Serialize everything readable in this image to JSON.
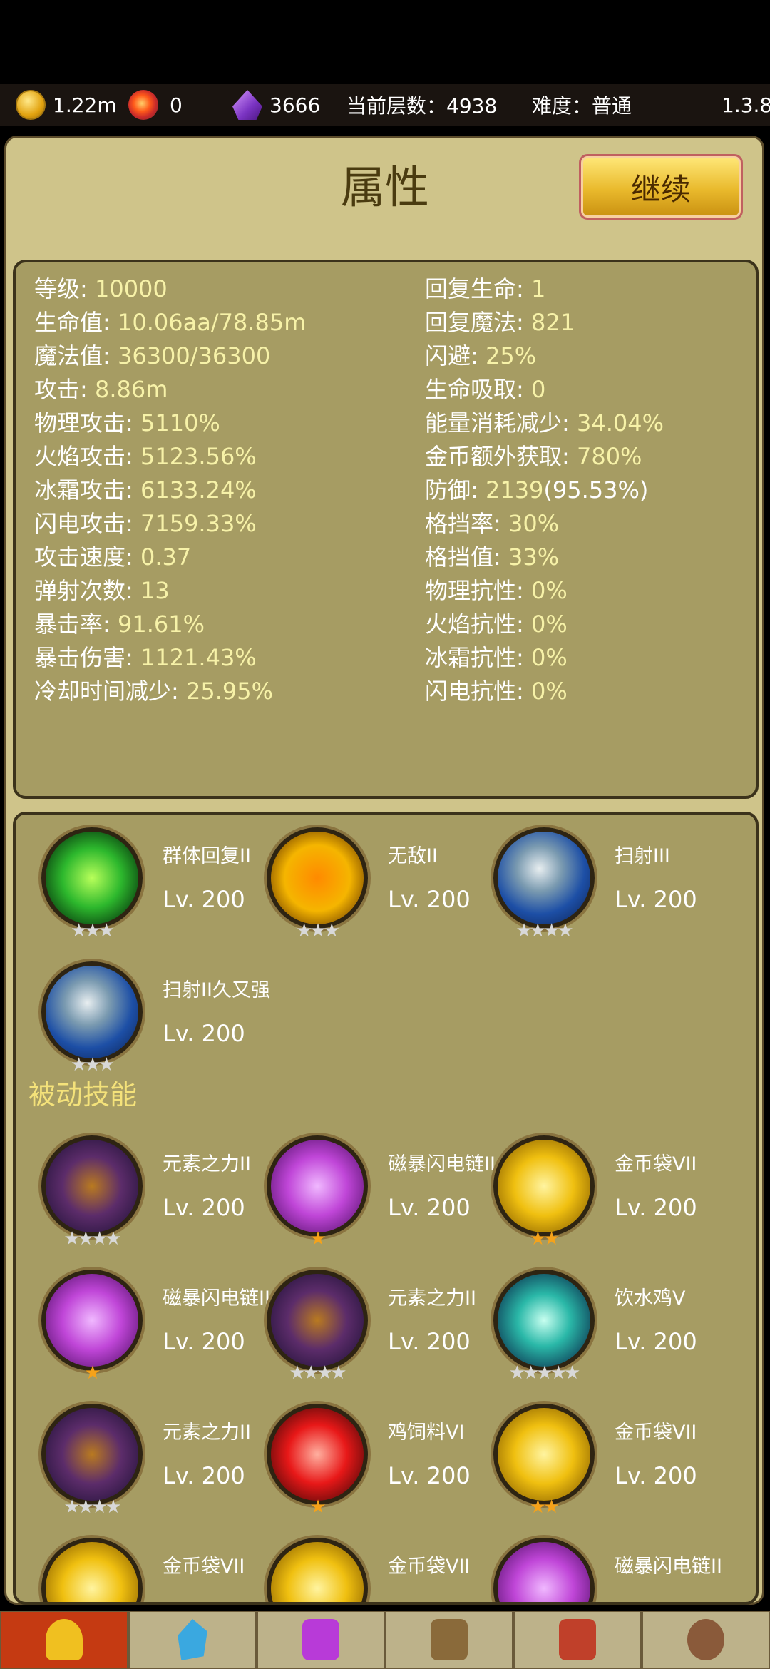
{
  "topbar": {
    "gold": "1.22m",
    "bombs": "0",
    "gems": "3666",
    "floor_label": "当前层数：4938",
    "difficulty_label": "难度：普通",
    "version": "1.3.8"
  },
  "header": {
    "title": "属性",
    "continue_label": "继续"
  },
  "stats_left": [
    {
      "label": "等级: ",
      "value": "10000"
    },
    {
      "label": "生命值: ",
      "value": "10.06aa/78.85m"
    },
    {
      "label": "魔法值: ",
      "value": "36300/36300"
    },
    {
      "label": "攻击: ",
      "value": "8.86m"
    },
    {
      "label": "物理攻击: ",
      "value": "5110%"
    },
    {
      "label": "火焰攻击: ",
      "value": "5123.56%"
    },
    {
      "label": "冰霜攻击: ",
      "value": "6133.24%"
    },
    {
      "label": "闪电攻击: ",
      "value": "7159.33%"
    },
    {
      "label": "攻击速度: ",
      "value": "0.37"
    },
    {
      "label": "弹射次数: ",
      "value": "13"
    },
    {
      "label": "暴击率: ",
      "value": "91.61%"
    },
    {
      "label": "暴击伤害: ",
      "value": "1121.43%"
    },
    {
      "label": "冷却时间减少: ",
      "value": "25.95%"
    }
  ],
  "stats_right": [
    {
      "label": "回复生命: ",
      "value": "1"
    },
    {
      "label": "回复魔法: ",
      "value": "821"
    },
    {
      "label": "闪避: ",
      "value": "25%"
    },
    {
      "label": "生命吸取: ",
      "value": "0"
    },
    {
      "label": "能量消耗减少: ",
      "value": "34.04%"
    },
    {
      "label": "金币额外获取: ",
      "value": "780%"
    },
    {
      "label": "防御: ",
      "value": "2139",
      "extra": "(95.53%)"
    },
    {
      "label": "格挡率: ",
      "value": "30%"
    },
    {
      "label": "格挡值: ",
      "value": "33%"
    },
    {
      "label": "物理抗性: ",
      "value": "0%"
    },
    {
      "label": "火焰抗性: ",
      "value": "0%"
    },
    {
      "label": "冰霜抗性: ",
      "value": "0%"
    },
    {
      "label": "闪电抗性: ",
      "value": "0%"
    }
  ],
  "active_skills": [
    {
      "name": "群体回复II",
      "level": "Lv. 200",
      "stars": 3,
      "star_color": "silver",
      "icon": "heal-swirl-icon",
      "theme": "green"
    },
    {
      "name": "无敌II",
      "level": "Lv. 200",
      "stars": 3,
      "star_color": "silver",
      "icon": "shield-cross-icon",
      "theme": "shield"
    },
    {
      "name": "扫射III",
      "level": "Lv. 200",
      "stars": 4,
      "star_color": "silver",
      "icon": "rock-barrage-icon",
      "theme": "blue"
    },
    {
      "name": "扫射II久又强",
      "level": "Lv. 200",
      "stars": 3,
      "star_color": "silver",
      "icon": "rock-barrage-icon",
      "theme": "blue"
    }
  ],
  "passive_label": "被动技能",
  "passive_skills": [
    {
      "name": "元素之力II",
      "level": "Lv. 200",
      "stars": 4,
      "star_color": "silver",
      "icon": "element-power-icon",
      "theme": "dark"
    },
    {
      "name": "磁暴闪电链II",
      "level": "Lv. 200",
      "stars": 1,
      "star_color": "gold",
      "icon": "lightning-chain-icon",
      "theme": "purple"
    },
    {
      "name": "金币袋VII",
      "level": "Lv. 200",
      "stars": 2,
      "star_color": "gold",
      "icon": "gold-coin-icon",
      "theme": "gold"
    },
    {
      "name": "磁暴闪电链II",
      "level": "Lv. 200",
      "stars": 1,
      "star_color": "gold",
      "icon": "lightning-chain-icon",
      "theme": "purple"
    },
    {
      "name": "元素之力II",
      "level": "Lv. 200",
      "stars": 4,
      "star_color": "silver",
      "icon": "element-power-icon",
      "theme": "dark"
    },
    {
      "name": "饮水鸡V",
      "level": "Lv. 200",
      "stars": 5,
      "star_color": "silver",
      "icon": "water-swirl-icon",
      "theme": "teal"
    },
    {
      "name": "元素之力II",
      "level": "Lv. 200",
      "stars": 4,
      "star_color": "silver",
      "icon": "element-power-icon",
      "theme": "dark"
    },
    {
      "name": "鸡饲料VI",
      "level": "Lv. 200",
      "stars": 1,
      "star_color": "gold",
      "icon": "blood-drop-icon",
      "theme": "red"
    },
    {
      "name": "金币袋VII",
      "level": "Lv. 200",
      "stars": 2,
      "star_color": "gold",
      "icon": "gold-coin-icon",
      "theme": "gold"
    },
    {
      "name": "金币袋VII",
      "level": "",
      "stars": 0,
      "star_color": "gold",
      "icon": "gold-coin-icon",
      "theme": "gold"
    },
    {
      "name": "金币袋VII",
      "level": "",
      "stars": 0,
      "star_color": "gold",
      "icon": "gold-coin-icon",
      "theme": "gold"
    },
    {
      "name": "磁暴闪电链II",
      "level": "",
      "stars": 0,
      "star_color": "gold",
      "icon": "lightning-chain-icon",
      "theme": "purple"
    }
  ],
  "nav": [
    {
      "icon": "character-icon",
      "active": true
    },
    {
      "icon": "crystal-icon",
      "active": false
    },
    {
      "icon": "magic-rune-icon",
      "active": false
    },
    {
      "icon": "anvil-forge-icon",
      "active": false
    },
    {
      "icon": "spellbook-icon",
      "active": false
    },
    {
      "icon": "settings-gear-icon",
      "active": false
    }
  ]
}
